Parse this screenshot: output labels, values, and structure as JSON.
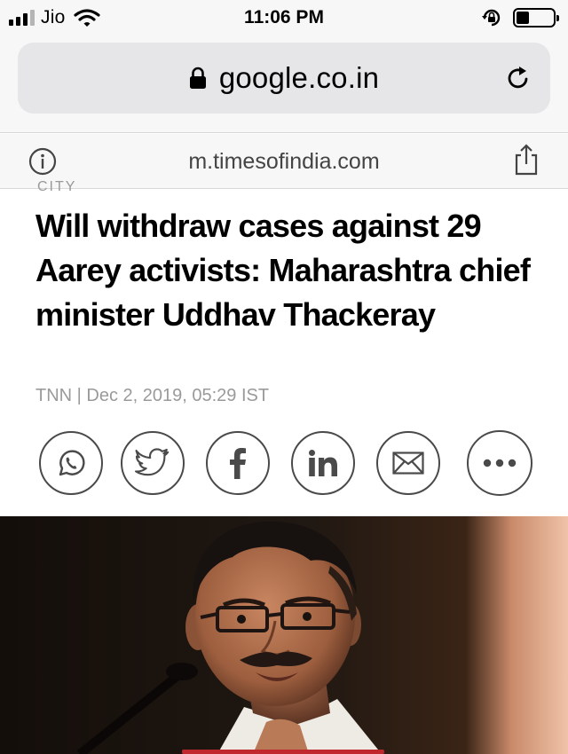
{
  "status_bar": {
    "carrier": "Jio",
    "time": "11:06 PM",
    "signal_bars_filled": 3,
    "signal_bars_total": 4,
    "battery_level": 0.35
  },
  "browser": {
    "url": "google.co.in",
    "site": "m.timesofindia.com"
  },
  "article": {
    "section_label": "CITY",
    "headline": "Will withdraw cases against 29 Aarey activists: Maharashtra chief minister Uddhav Thackeray",
    "byline": "TNN | Dec 2, 2019, 05:29 IST"
  },
  "share_buttons": [
    {
      "icon": "whatsapp-icon"
    },
    {
      "icon": "twitter-icon"
    },
    {
      "icon": "facebook-icon",
      "glyph": "f"
    },
    {
      "icon": "linkedin-icon",
      "glyph": "in"
    },
    {
      "icon": "mail-icon"
    },
    {
      "icon": "more-icon"
    }
  ],
  "colors": {
    "chrome_bg": "#f7f7f7",
    "url_field_bg": "#e6e6e8",
    "byline_gray": "#9a9a9a",
    "icon_stroke": "#4a4a4a",
    "photo_accent": "#c0282d"
  }
}
